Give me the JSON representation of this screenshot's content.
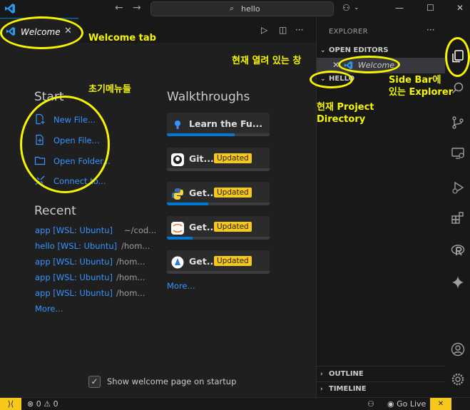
{
  "title_bar": {
    "search_text": "hello"
  },
  "tab": {
    "label": "Welcome"
  },
  "welcome": {
    "start_title": "Start",
    "start_items": [
      {
        "label": "New File..."
      },
      {
        "label": "Open File..."
      },
      {
        "label": "Open Folder..."
      },
      {
        "label": "Connect to..."
      }
    ],
    "recent_title": "Recent",
    "recent_items": [
      {
        "name": "app [WSL: Ubuntu]",
        "path": "~/cod..."
      },
      {
        "name": "hello [WSL: Ubuntu]",
        "path": "/hom..."
      },
      {
        "name": "app [WSL: Ubuntu]",
        "path": "/hom..."
      },
      {
        "name": "app [WSL: Ubuntu]",
        "path": "/hom..."
      },
      {
        "name": "app [WSL: Ubuntu]",
        "path": "/hom..."
      }
    ],
    "recent_more": "More...",
    "walkthroughs_title": "Walkthroughs",
    "walkthroughs": [
      {
        "label": "Learn the Fu...",
        "badge": "",
        "progress": 0.66
      },
      {
        "label": "Git...",
        "badge": "Updated",
        "progress": 0.0
      },
      {
        "label": "Get...",
        "badge": "Updated",
        "progress": 0.4
      },
      {
        "label": "Get...",
        "badge": "Updated",
        "progress": 0.25
      },
      {
        "label": "Get...",
        "badge": "Updated",
        "progress": 0.0
      }
    ],
    "walkthroughs_more": "More...",
    "show_on_startup_label": "Show welcome page on startup",
    "show_on_startup_checked": true
  },
  "sidebar": {
    "title": "EXPLORER",
    "open_editors_label": "OPEN EDITORS",
    "open_editor_item": "Welcome",
    "folder_label": "HELLO",
    "outline_label": "OUTLINE",
    "timeline_label": "TIMELINE"
  },
  "status_bar": {
    "errors": "0",
    "warnings": "0",
    "go_live": "Go Live"
  },
  "annotations": {
    "welcome_tab": "Welcome tab",
    "initial_menus": "초기메뉴들",
    "open_window": "현재 열려 있는 창",
    "project_dir_line1": "현재 Project",
    "project_dir_line2": "Directory",
    "sidebar_explorer_line1": "Side Bar에",
    "sidebar_explorer_line2": "있는 Explorer"
  },
  "colors": {
    "accent": "#0078d4",
    "link": "#3794ff",
    "annotation": "#f5f500",
    "badge": "#f7c719"
  }
}
